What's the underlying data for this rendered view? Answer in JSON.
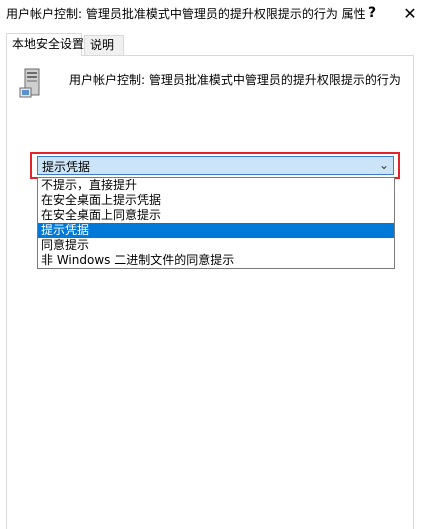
{
  "window": {
    "title": "用户帐户控制: 管理员批准模式中管理员的提升权限提示的行为 属性",
    "help_label": "?",
    "close_label": "✕"
  },
  "tabs": [
    {
      "label": "本地安全设置",
      "active": true
    },
    {
      "label": "说明",
      "active": false
    }
  ],
  "policy": {
    "icon": "server-computer-icon",
    "description": "用户帐户控制: 管理员批准模式中管理员的提升权限提示的行为"
  },
  "select": {
    "value": "提示凭据",
    "arrow": "⌄",
    "options": [
      "不提示，直接提升",
      "在安全桌面上提示凭据",
      "在安全桌面上同意提示",
      "提示凭据",
      "同意提示",
      "非 Windows 二进制文件的同意提示"
    ],
    "selected_index": 3
  },
  "colors": {
    "highlight_border": "#e0262a",
    "selected_option_bg": "#0078d7",
    "combo_bg": "#cce4f7"
  }
}
